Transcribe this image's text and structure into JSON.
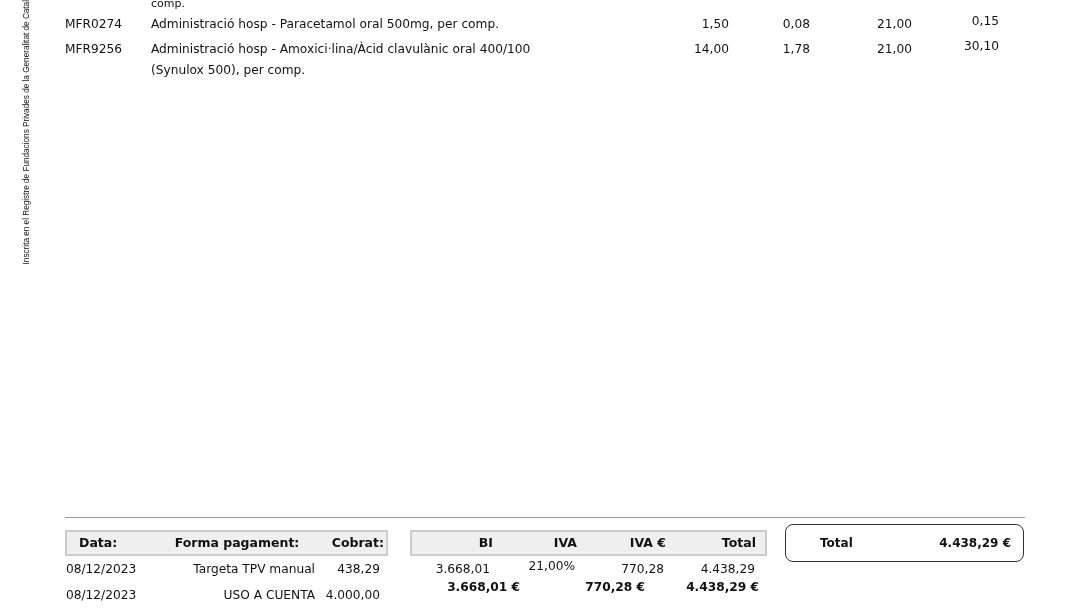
{
  "side_note": "Inscrita en el Registre de Fundacions Privades de la Generalitat de Catal",
  "cut_line": "comp.",
  "lines": [
    {
      "code": "MFR0274",
      "description": "Administració hosp - Paracetamol oral 500mg, per comp.",
      "column_3": "1,50",
      "column_4": "0,08",
      "column_5": "21,00",
      "column_6": "0,15"
    },
    {
      "code": "MFR9256",
      "description": "Administració hosp - Amoxici·lina/Àcid clavulànic oral 400/100 (Synulox 500), per comp.",
      "column_3": "14,00",
      "column_4": "1,78",
      "column_5": "21,00",
      "column_6": "30,10"
    }
  ],
  "payments": {
    "columns": [
      "Data:",
      "Forma pagament:",
      "Cobrat:"
    ],
    "rows": [
      [
        "08/12/2023",
        "Targeta TPV manual",
        "438,29"
      ],
      [
        "08/12/2023",
        "USO A CUENTA",
        "4.000,00"
      ]
    ]
  },
  "taxes": {
    "columns": [
      "BI",
      "IVA",
      "IVA €",
      "Total"
    ],
    "rows": [
      [
        "3.668,01",
        "21,00%",
        "770,28",
        "4.438,29"
      ]
    ],
    "totals": [
      "3.668,01 €",
      "770,28 €",
      "4.438,29 €"
    ]
  },
  "grand_total": {
    "label": "Total",
    "value": "4.438,29 €"
  }
}
